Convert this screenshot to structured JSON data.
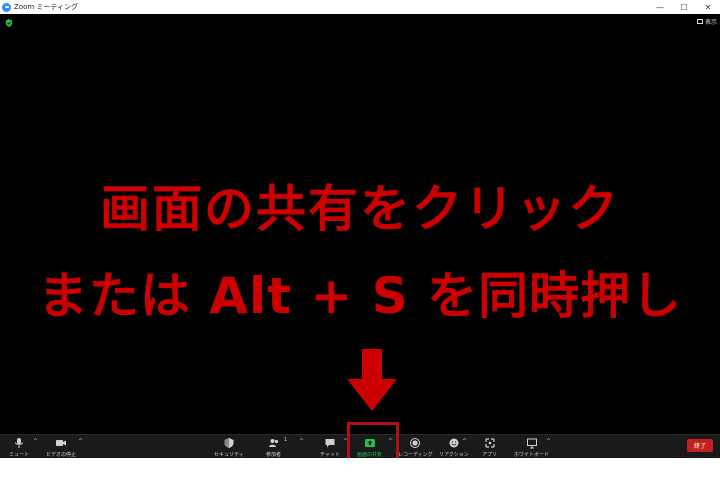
{
  "window": {
    "title": "Zoom ミーティング",
    "controls": [
      "—",
      "☐",
      "✕"
    ]
  },
  "stage": {
    "view_label": "表示"
  },
  "instructions": {
    "line1": "画面の共有をクリック",
    "line2": "または Alt + S を同時押し"
  },
  "toolbar": {
    "mute": "ミュート",
    "video": "ビデオの停止",
    "security": "セキュリティ",
    "participants": "参加者",
    "participants_count": "1",
    "chat": "チャット",
    "share": "画面の共有",
    "record": "レコーディング",
    "reactions": "リアクション",
    "apps": "アプリ",
    "whiteboard": "ホワイトボード",
    "end": "終了",
    "caret": "^"
  },
  "colors": {
    "instruction_text": "#cc0000",
    "share_green": "#25c04a",
    "end_red": "#c4231d",
    "highlight": "#b01010"
  }
}
